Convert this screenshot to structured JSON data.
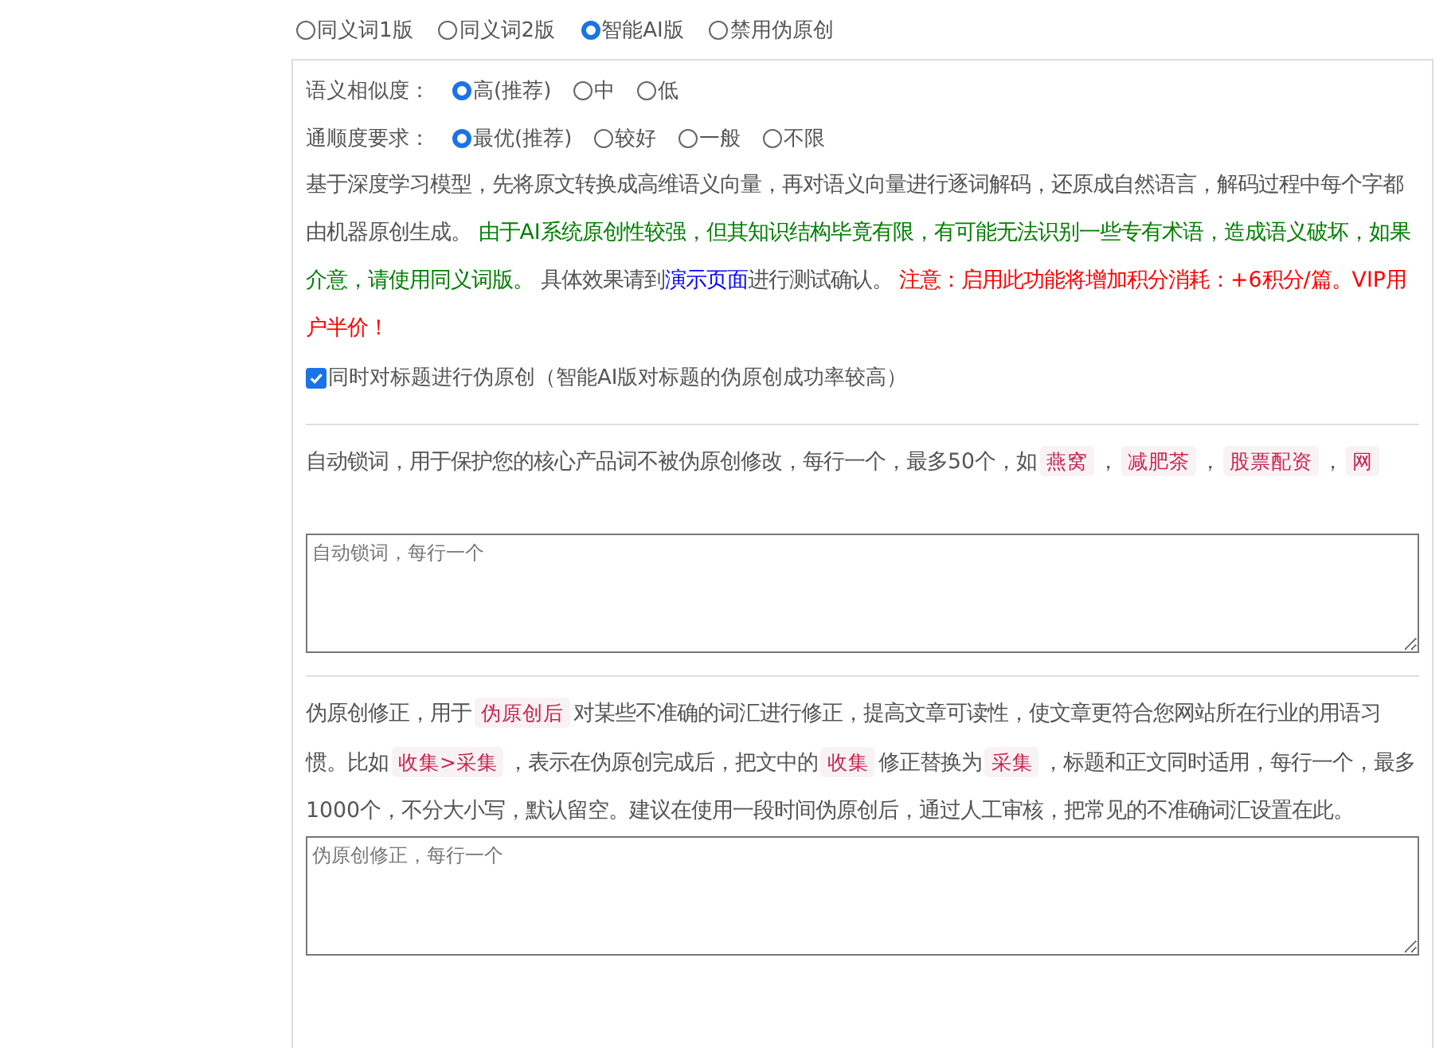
{
  "modes": [
    {
      "label": "同义词1版",
      "selected": false
    },
    {
      "label": "同义词2版",
      "selected": false
    },
    {
      "label": "智能AI版",
      "selected": true
    },
    {
      "label": "禁用伪原创",
      "selected": false
    }
  ],
  "similarity": {
    "label": "语义相似度：",
    "options": [
      {
        "label": "高(推荐)",
        "selected": true
      },
      {
        "label": "中",
        "selected": false
      },
      {
        "label": "低",
        "selected": false
      }
    ]
  },
  "fluency": {
    "label": "通顺度要求：",
    "options": [
      {
        "label": "最优(推荐)",
        "selected": true
      },
      {
        "label": "较好",
        "selected": false
      },
      {
        "label": "一般",
        "selected": false
      },
      {
        "label": "不限",
        "selected": false
      }
    ]
  },
  "ai_description": [
    {
      "kind": "plain",
      "text": "基于深度学习模型，先将原文转换成高维语义向量，再对语义向量进行逐词解码，还原成自然语言，解码过程中每个字都由机器原创生成。 "
    },
    {
      "kind": "green",
      "text": "由于AI系统原创性较强，但其知识结构毕竟有限，有可能无法识别一些专有术语，造成语义破坏，如果介意，请使用同义词版。"
    },
    {
      "kind": "plain",
      "text": " 具体效果请到"
    },
    {
      "kind": "link",
      "text": "演示页面"
    },
    {
      "kind": "plain",
      "text": "进行测试确认。 "
    },
    {
      "kind": "red",
      "text": "注意：启用此功能将增加积分消耗：+6积分/篇。VIP用户半价！"
    }
  ],
  "title_option": {
    "label": "同时对标题进行伪原创（智能AI版对标题的伪原创成功率较高）",
    "checked": true
  },
  "lock_words": {
    "description": [
      {
        "kind": "plain",
        "text": "自动锁词，用于保护您的核心产品词不被伪原创修改，每行一个，最多50个，如"
      },
      {
        "kind": "code",
        "text": "燕窝"
      },
      {
        "kind": "plain",
        "text": "，"
      },
      {
        "kind": "code",
        "text": "减肥茶"
      },
      {
        "kind": "plain",
        "text": "，"
      },
      {
        "kind": "code",
        "text": "股票配资"
      },
      {
        "kind": "plain",
        "text": "，"
      },
      {
        "kind": "code",
        "text": "网"
      }
    ],
    "placeholder": "自动锁词，每行一个"
  },
  "correction": {
    "description": [
      {
        "kind": "plain",
        "text": "伪原创修正，用于"
      },
      {
        "kind": "code",
        "text": "伪原创后"
      },
      {
        "kind": "plain",
        "text": "对某些不准确的词汇进行修正，提高文章可读性，使文章更符合您网站所在行业的用语习惯。比如"
      },
      {
        "kind": "code",
        "text": "收集>采集"
      },
      {
        "kind": "plain",
        "text": "，表示在伪原创完成后，把文中的"
      },
      {
        "kind": "code",
        "text": "收集"
      },
      {
        "kind": "plain",
        "text": "修正替换为"
      },
      {
        "kind": "code",
        "text": "采集"
      },
      {
        "kind": "plain",
        "text": "，标题和正文同时适用，每行一个，最多1000个，不分大小写，默认留空。建议在使用一段时间伪原创后，通过人工审核，把常见的不准确词汇设置在此。"
      }
    ],
    "placeholder": "伪原创修正，每行一个"
  }
}
